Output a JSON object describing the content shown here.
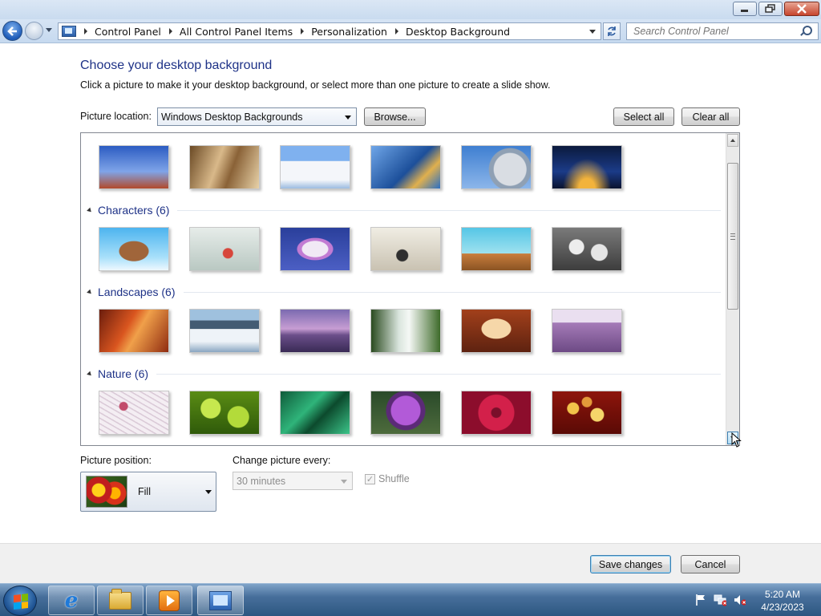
{
  "window": {
    "controls": {
      "minimize": "minimize-icon",
      "maximize": "restore-icon",
      "close": "close-icon"
    }
  },
  "nav": {
    "breadcrumbs": [
      "Control Panel",
      "All Control Panel Items",
      "Personalization",
      "Desktop Background"
    ],
    "search_placeholder": "Search Control Panel"
  },
  "page": {
    "title": "Choose your desktop background",
    "subtitle": "Click a picture to make it your desktop background, or select more than one picture to create a slide show.",
    "picture_location_label": "Picture location:",
    "picture_location_value": "Windows Desktop Backgrounds",
    "browse_label": "Browse...",
    "select_all_label": "Select all",
    "clear_all_label": "Clear all"
  },
  "groups": [
    {
      "title": "",
      "thumbs": [
        "space-needle",
        "abstract-arches",
        "white-building",
        "blue-architecture",
        "silver-dome",
        "night-bridge"
      ]
    },
    {
      "title": "Characters (6)",
      "thumbs": [
        "floating-island",
        "fantasy-room",
        "character-blue",
        "insect-sketch",
        "creature-sky",
        "gray-figures"
      ]
    },
    {
      "title": "Landscapes (6)",
      "thumbs": [
        "red-canyon",
        "ice-lake",
        "purple-coast",
        "waterfall",
        "rock-arch",
        "lavender-field"
      ]
    },
    {
      "title": "Nature (6)",
      "thumbs": [
        "white-flower",
        "green-bubbles",
        "green-leaves",
        "purple-thistle",
        "red-dahlia",
        "autumn-leaves"
      ]
    }
  ],
  "bottom": {
    "picture_position_label": "Picture position:",
    "picture_position_value": "Fill",
    "change_every_label": "Change picture every:",
    "change_every_value": "30 minutes",
    "shuffle_label": "Shuffle",
    "shuffle_checked": true
  },
  "footer": {
    "save_label": "Save changes",
    "cancel_label": "Cancel"
  },
  "taskbar": {
    "apps": [
      "internet-explorer-icon",
      "folder-icon",
      "media-player-icon",
      "control-panel-icon"
    ],
    "tray": [
      "action-center-flag-icon",
      "network-icon",
      "volume-muted-icon"
    ],
    "time": "5:20 AM",
    "date": "4/23/2023"
  }
}
